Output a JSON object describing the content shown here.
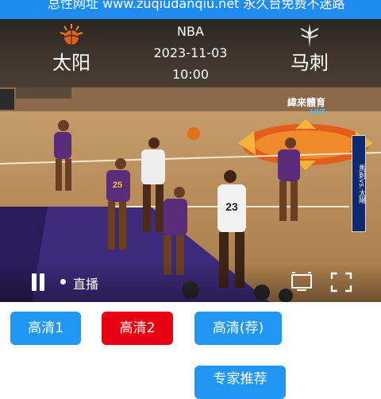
{
  "banner": {
    "text": "总性网址 www.zuqiudanqiu.net 永久台免费不迷路"
  },
  "match": {
    "league": "NBA",
    "date": "2023-11-03",
    "time": "10:00",
    "home_team": "太阳",
    "away_team": "马刺",
    "home_logo_icon": "suns-logo-icon",
    "away_logo_icon": "spurs-logo-icon"
  },
  "player": {
    "status_label": "直播",
    "broadcaster": "緯來體育",
    "broadcaster_live": "LIVE",
    "side_banner": "馬刺vs.太陽",
    "jersey_numbers": [
      "23",
      "25"
    ]
  },
  "streams": [
    {
      "label": "高清1",
      "active": false
    },
    {
      "label": "高清2",
      "active": true
    },
    {
      "label": "高清(荐)",
      "active": false
    }
  ],
  "expert": {
    "label": "专家推荐"
  },
  "colors": {
    "accent": "#2196f3",
    "active": "#e60012",
    "banner": "#1e8cf0"
  }
}
